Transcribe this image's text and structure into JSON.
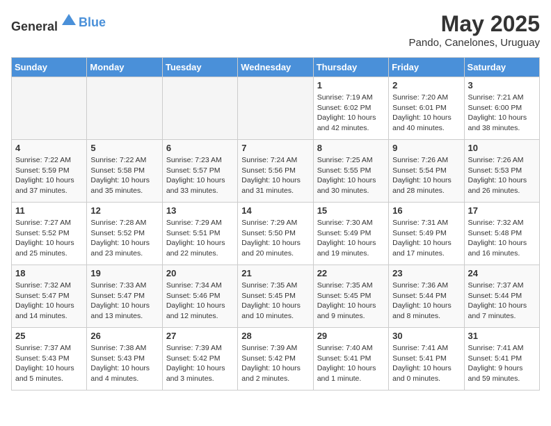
{
  "header": {
    "logo_general": "General",
    "logo_blue": "Blue",
    "month_year": "May 2025",
    "location": "Pando, Canelones, Uruguay"
  },
  "days_of_week": [
    "Sunday",
    "Monday",
    "Tuesday",
    "Wednesday",
    "Thursday",
    "Friday",
    "Saturday"
  ],
  "weeks": [
    [
      {
        "day": "",
        "empty": true
      },
      {
        "day": "",
        "empty": true
      },
      {
        "day": "",
        "empty": true
      },
      {
        "day": "",
        "empty": true
      },
      {
        "day": "1",
        "sunrise": "7:19 AM",
        "sunset": "6:02 PM",
        "daylight": "10 hours and 42 minutes."
      },
      {
        "day": "2",
        "sunrise": "7:20 AM",
        "sunset": "6:01 PM",
        "daylight": "10 hours and 40 minutes."
      },
      {
        "day": "3",
        "sunrise": "7:21 AM",
        "sunset": "6:00 PM",
        "daylight": "10 hours and 38 minutes."
      }
    ],
    [
      {
        "day": "4",
        "sunrise": "7:22 AM",
        "sunset": "5:59 PM",
        "daylight": "10 hours and 37 minutes."
      },
      {
        "day": "5",
        "sunrise": "7:22 AM",
        "sunset": "5:58 PM",
        "daylight": "10 hours and 35 minutes."
      },
      {
        "day": "6",
        "sunrise": "7:23 AM",
        "sunset": "5:57 PM",
        "daylight": "10 hours and 33 minutes."
      },
      {
        "day": "7",
        "sunrise": "7:24 AM",
        "sunset": "5:56 PM",
        "daylight": "10 hours and 31 minutes."
      },
      {
        "day": "8",
        "sunrise": "7:25 AM",
        "sunset": "5:55 PM",
        "daylight": "10 hours and 30 minutes."
      },
      {
        "day": "9",
        "sunrise": "7:26 AM",
        "sunset": "5:54 PM",
        "daylight": "10 hours and 28 minutes."
      },
      {
        "day": "10",
        "sunrise": "7:26 AM",
        "sunset": "5:53 PM",
        "daylight": "10 hours and 26 minutes."
      }
    ],
    [
      {
        "day": "11",
        "sunrise": "7:27 AM",
        "sunset": "5:52 PM",
        "daylight": "10 hours and 25 minutes."
      },
      {
        "day": "12",
        "sunrise": "7:28 AM",
        "sunset": "5:52 PM",
        "daylight": "10 hours and 23 minutes."
      },
      {
        "day": "13",
        "sunrise": "7:29 AM",
        "sunset": "5:51 PM",
        "daylight": "10 hours and 22 minutes."
      },
      {
        "day": "14",
        "sunrise": "7:29 AM",
        "sunset": "5:50 PM",
        "daylight": "10 hours and 20 minutes."
      },
      {
        "day": "15",
        "sunrise": "7:30 AM",
        "sunset": "5:49 PM",
        "daylight": "10 hours and 19 minutes."
      },
      {
        "day": "16",
        "sunrise": "7:31 AM",
        "sunset": "5:49 PM",
        "daylight": "10 hours and 17 minutes."
      },
      {
        "day": "17",
        "sunrise": "7:32 AM",
        "sunset": "5:48 PM",
        "daylight": "10 hours and 16 minutes."
      }
    ],
    [
      {
        "day": "18",
        "sunrise": "7:32 AM",
        "sunset": "5:47 PM",
        "daylight": "10 hours and 14 minutes."
      },
      {
        "day": "19",
        "sunrise": "7:33 AM",
        "sunset": "5:47 PM",
        "daylight": "10 hours and 13 minutes."
      },
      {
        "day": "20",
        "sunrise": "7:34 AM",
        "sunset": "5:46 PM",
        "daylight": "10 hours and 12 minutes."
      },
      {
        "day": "21",
        "sunrise": "7:35 AM",
        "sunset": "5:45 PM",
        "daylight": "10 hours and 10 minutes."
      },
      {
        "day": "22",
        "sunrise": "7:35 AM",
        "sunset": "5:45 PM",
        "daylight": "10 hours and 9 minutes."
      },
      {
        "day": "23",
        "sunrise": "7:36 AM",
        "sunset": "5:44 PM",
        "daylight": "10 hours and 8 minutes."
      },
      {
        "day": "24",
        "sunrise": "7:37 AM",
        "sunset": "5:44 PM",
        "daylight": "10 hours and 7 minutes."
      }
    ],
    [
      {
        "day": "25",
        "sunrise": "7:37 AM",
        "sunset": "5:43 PM",
        "daylight": "10 hours and 5 minutes."
      },
      {
        "day": "26",
        "sunrise": "7:38 AM",
        "sunset": "5:43 PM",
        "daylight": "10 hours and 4 minutes."
      },
      {
        "day": "27",
        "sunrise": "7:39 AM",
        "sunset": "5:42 PM",
        "daylight": "10 hours and 3 minutes."
      },
      {
        "day": "28",
        "sunrise": "7:39 AM",
        "sunset": "5:42 PM",
        "daylight": "10 hours and 2 minutes."
      },
      {
        "day": "29",
        "sunrise": "7:40 AM",
        "sunset": "5:41 PM",
        "daylight": "10 hours and 1 minute."
      },
      {
        "day": "30",
        "sunrise": "7:41 AM",
        "sunset": "5:41 PM",
        "daylight": "10 hours and 0 minutes."
      },
      {
        "day": "31",
        "sunrise": "7:41 AM",
        "sunset": "5:41 PM",
        "daylight": "9 hours and 59 minutes."
      }
    ]
  ],
  "labels": {
    "sunrise": "Sunrise:",
    "sunset": "Sunset:",
    "daylight": "Daylight:"
  }
}
